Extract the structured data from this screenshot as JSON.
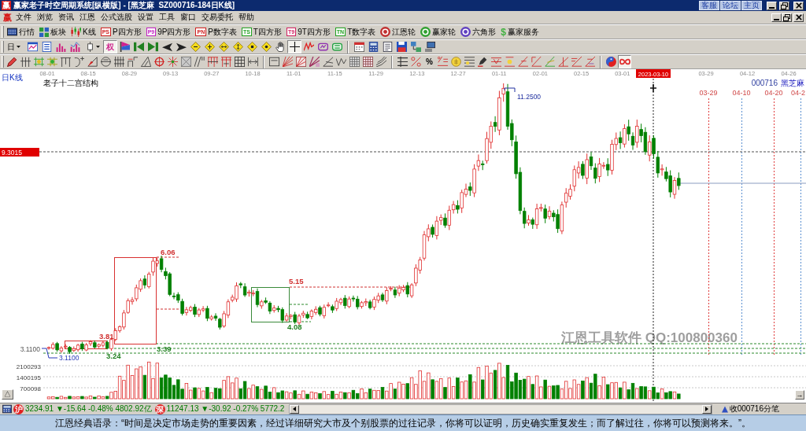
{
  "window": {
    "logo": "赢",
    "title": "赢家老子时空周期系统[纵横版] - [黑芝麻  SZ000716-184日K线]",
    "links": [
      "客服",
      "论坛",
      "主页"
    ]
  },
  "menu_bar": {
    "logo": "赢",
    "items": [
      "文件",
      "浏览",
      "资讯",
      "江恩",
      "公式选股",
      "设置",
      "工具",
      "窗口",
      "交易委托",
      "帮助"
    ]
  },
  "toolbar_1": {
    "items": [
      {
        "kind": "screen",
        "label": "行情"
      },
      {
        "kind": "tiles",
        "label": "板块"
      },
      {
        "kind": "candles",
        "label": "K线"
      },
      {
        "kind": "badge",
        "badge": "PS",
        "color": "#d02020",
        "label": "P四方形"
      },
      {
        "kind": "badge",
        "badge": "P9",
        "color": "#c020c0",
        "label": "9P四方形"
      },
      {
        "kind": "badge",
        "badge": "PN",
        "color": "#d02020",
        "label": "P数字表"
      },
      {
        "kind": "badge",
        "badge": "TS",
        "color": "#20a020",
        "label": "T四方形"
      },
      {
        "kind": "badge",
        "badge": "T9",
        "color": "#d02060",
        "label": "9T四方形"
      },
      {
        "kind": "badge",
        "badge": "TN",
        "color": "#20a020",
        "label": "T数字表"
      },
      {
        "kind": "wheel",
        "color": "#c03030",
        "label": "江恩轮"
      },
      {
        "kind": "wheel",
        "color": "#30a030",
        "label": "赢家轮"
      },
      {
        "kind": "wheel",
        "color": "#6040c0",
        "label": "六角形"
      },
      {
        "kind": "sign",
        "badge": "$",
        "color": "#40b040",
        "label": "赢家服务"
      }
    ]
  },
  "toolbar_2": {
    "period": "日",
    "buttons": [
      {
        "on": false
      },
      {
        "on": false
      },
      {
        "on": false
      },
      {
        "on": false
      },
      {
        "on": false
      },
      {
        "label": "权",
        "on": true
      },
      {
        "on": false
      },
      {
        "on": false
      },
      {
        "on": false
      },
      {
        "on": false
      },
      {
        "on": false
      },
      {
        "on": false
      },
      {
        "on": false
      },
      {
        "on": false
      },
      {
        "on": false
      },
      {
        "on": false
      },
      {
        "on": false
      },
      {
        "on": false
      },
      {
        "on": true
      },
      {
        "on": false
      },
      {
        "on": false
      },
      {
        "on": false
      },
      {
        "on": false
      },
      {
        "on": false
      },
      {
        "on": false
      },
      {
        "on": false
      },
      {
        "on": false
      },
      {
        "on": false
      }
    ]
  },
  "toolbar_3": {
    "buttons": [
      {
        "on": false
      },
      {
        "on": false
      },
      {
        "on": false
      },
      {
        "on": false
      },
      {
        "on": false
      },
      {
        "on": false
      },
      {
        "on": false
      },
      {
        "on": false
      },
      {
        "on": false
      },
      {
        "on": false
      },
      {
        "on": false
      },
      {
        "on": false
      },
      {
        "on": false
      },
      {
        "on": false
      },
      {
        "on": false
      },
      {
        "on": false
      },
      {
        "on": false
      },
      {
        "on": false
      },
      {
        "on": false
      },
      {
        "on": false
      },
      {
        "on": false
      },
      {
        "on": false
      },
      {
        "on": false
      },
      {
        "on": false
      },
      {
        "on": false
      },
      {
        "on": false
      },
      {
        "on": false
      },
      {
        "on": false
      },
      {
        "on": false
      },
      {
        "on": false
      },
      {
        "label": "%",
        "on": false
      },
      {
        "on": false
      },
      {
        "on": false
      },
      {
        "on": false
      },
      {
        "on": false
      },
      {
        "on": false
      },
      {
        "on": false
      },
      {
        "on": false
      },
      {
        "on": false
      },
      {
        "on": false
      },
      {
        "on": false
      },
      {
        "on": false
      },
      {
        "on": false
      },
      {
        "on": false
      },
      {
        "on": true
      }
    ]
  },
  "chart": {
    "period": "日K线",
    "study": "老子十二宫结构",
    "axis_dates": [
      "08-01",
      "08-15",
      "08-29",
      "09-13",
      "09-27",
      "10-18",
      "11-01",
      "11-15",
      "11-29",
      "12-13",
      "12-27",
      "01-11",
      "02-01",
      "02-15",
      "03-01"
    ],
    "cursor_date": "2023-03-10",
    "future_axis_dates": [
      "03-29",
      "04-12",
      "04-26"
    ],
    "symbol": "000716",
    "name": "黑芝麻",
    "forecast_lines": [
      {
        "label": "03-29",
        "color": "#e03c3c"
      },
      {
        "label": "04-10",
        "color": "#5a8fd0"
      },
      {
        "label": "04-20",
        "color": "#e03c3c"
      },
      {
        "label": "04-2",
        "color": "#5a8fd0"
      }
    ],
    "price_marker": "9.3015",
    "peak_label": "11.2500",
    "low_label": "3.1100",
    "low_marker": "3.1100",
    "annotations": [
      {
        "text": "6.06",
        "color": "#d03030"
      },
      {
        "text": "3.81",
        "color": "#d03030"
      },
      {
        "text": "3.39",
        "color": "#208020"
      },
      {
        "text": "3.24",
        "color": "#208020"
      },
      {
        "text": "5.15",
        "color": "#d03030"
      },
      {
        "text": "4.08",
        "color": "#208020"
      }
    ],
    "volume_ticks": [
      "2100293",
      "1400195",
      "700098"
    ],
    "vendor_note": "江恩工具软件 QQ:100800360",
    "collapse_button": "△",
    "scroll_button": "→"
  },
  "status_bar": {
    "indices": [
      {
        "badge": "沪",
        "quote": "3234.91 ▼-15.64 -0.48% 4802.92亿"
      },
      {
        "badge": "深",
        "quote": "11247.13 ▼-30.92 -0.27% 5772.2"
      }
    ],
    "ticker": "收000716分笔"
  },
  "quote_bar": {
    "text": "江恩经典语录：“时间是决定市场走势的重要因素，经过详细研究大市及个别股票的过往记录，你将可以证明，历史确实重复发生；而了解过往，你将可以预测将来。”。"
  }
}
